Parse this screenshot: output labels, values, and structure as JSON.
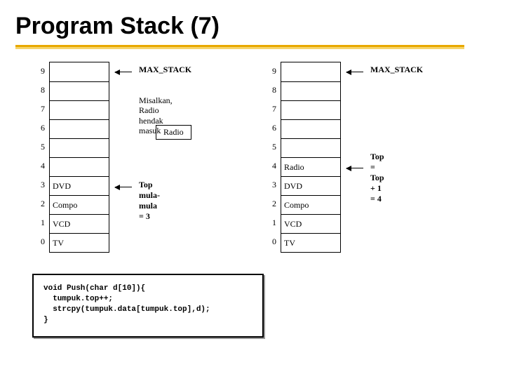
{
  "title": "Program Stack (7)",
  "left_stack": {
    "indices": [
      "9",
      "8",
      "7",
      "6",
      "5",
      "4",
      "3",
      "2",
      "1",
      "0"
    ],
    "cells": [
      "",
      "",
      "",
      "",
      "",
      "",
      "DVD",
      "Compo",
      "VCD",
      "TV"
    ]
  },
  "right_stack": {
    "indices": [
      "9",
      "8",
      "7",
      "6",
      "5",
      "4",
      "3",
      "2",
      "1",
      "0"
    ],
    "cells": [
      "",
      "",
      "",
      "",
      "",
      "Radio",
      "DVD",
      "Compo",
      "VCD",
      "TV"
    ]
  },
  "labels": {
    "max_stack_left": "MAX_STACK",
    "max_stack_right": "MAX_STACK",
    "note_left": "Misalkan, Radio hendak\nmasuk",
    "radio_box": "Radio",
    "top_left": "Top mula-mula = 3",
    "top_right": "Top = Top + 1 = 4"
  },
  "code": {
    "l1": "void Push(char d[10]){",
    "l2": "  tumpuk.top++;",
    "l3": "  strcpy(tumpuk.data[tumpuk.top],d);",
    "l4": "}"
  }
}
